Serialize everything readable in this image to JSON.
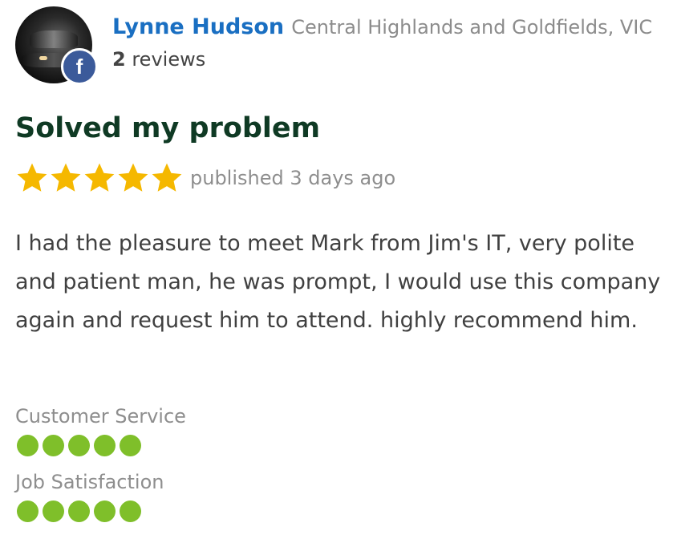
{
  "reviewer": {
    "name": "Lynne Hudson",
    "location": "Central Highlands and Goldfields, VIC",
    "review_count": "2",
    "review_count_suffix": "reviews",
    "social_badge": "f"
  },
  "review": {
    "title": "Solved my problem",
    "rating": 5,
    "rating_max": 5,
    "published": "published 3 days ago",
    "body": "I had the pleasure to meet Mark from Jim's IT, very polite and patient man, he was prompt, I would use this company again and request him to attend. highly recommend him."
  },
  "criteria": [
    {
      "label": "Customer Service",
      "score": 5,
      "max": 5
    },
    {
      "label": "Job Satisfaction",
      "score": 5,
      "max": 5
    }
  ],
  "colors": {
    "name_link": "#1a6fc2",
    "title": "#0f3a24",
    "star": "#f5b800",
    "score_dot": "#7fbf2a",
    "facebook": "#3b5a9a"
  },
  "icons": {
    "avatar": "profile-photo",
    "badge": "facebook-icon",
    "star": "star-icon",
    "dot": "score-dot-icon"
  }
}
